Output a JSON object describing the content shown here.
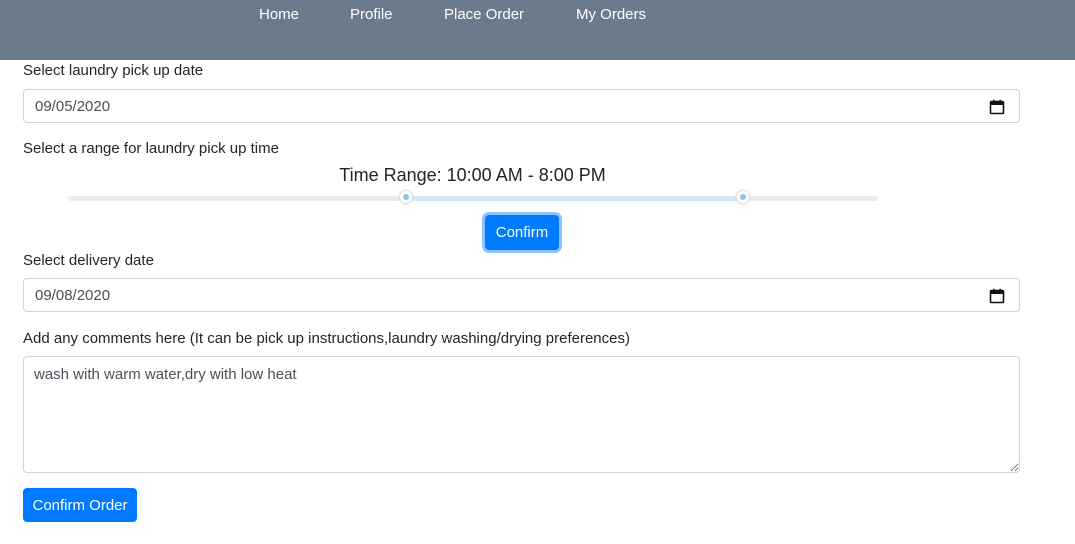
{
  "nav": {
    "items": [
      {
        "label": "Home"
      },
      {
        "label": "Profile"
      },
      {
        "label": "Place Order"
      },
      {
        "label": "My Orders"
      }
    ]
  },
  "pickup_date": {
    "label": "Select laundry pick up date",
    "value": "09/05/2020",
    "icon": "calendar-icon"
  },
  "time_range": {
    "label": "Select a range for laundry pick up time",
    "display": "Time Range: 10:00 AM - 8:00 PM",
    "confirm_label": "Confirm"
  },
  "delivery_date": {
    "label": "Select delivery date",
    "value": "09/08/2020",
    "icon": "calendar-icon"
  },
  "comments": {
    "label": "Add any comments here (It can be pick up instructions,laundry washing/drying preferences)",
    "value": "wash with warm water,dry with low heat"
  },
  "confirm_order_label": "Confirm Order",
  "colors": {
    "navbar": "#6c7b8b",
    "primary": "#007bff"
  }
}
